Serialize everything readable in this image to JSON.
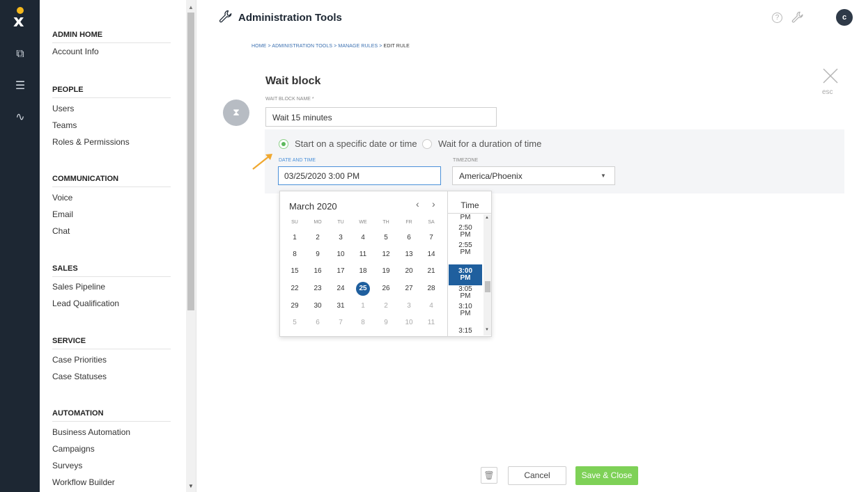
{
  "app": {
    "title": "Administration Tools",
    "avatar_initial": "c",
    "help_glyph": "?"
  },
  "sidebar": {
    "sections": [
      {
        "title": "ADMIN HOME",
        "items": [
          "Account Info"
        ]
      },
      {
        "title": "PEOPLE",
        "items": [
          "Users",
          "Teams",
          "Roles & Permissions"
        ]
      },
      {
        "title": "COMMUNICATION",
        "items": [
          "Voice",
          "Email",
          "Chat"
        ]
      },
      {
        "title": "SALES",
        "items": [
          "Sales Pipeline",
          "Lead Qualification"
        ]
      },
      {
        "title": "SERVICE",
        "items": [
          "Case Priorities",
          "Case Statuses"
        ]
      },
      {
        "title": "AUTOMATION",
        "items": [
          "Business Automation",
          "Campaigns",
          "Surveys",
          "Workflow Builder"
        ]
      }
    ]
  },
  "breadcrumb": {
    "home": "HOME",
    "admin": "ADMINISTRATION TOOLS",
    "rules": "MANAGE RULES",
    "current": "EDIT RULE",
    "sep": ">"
  },
  "form": {
    "block_title": "Wait block",
    "name_label": "WAIT BLOCK NAME *",
    "name_value": "Wait 15 minutes",
    "option_specific": "Start on a specific date or time",
    "option_duration": "Wait for a duration of time",
    "selected_option": "specific",
    "datetime_label": "DATE AND TIME",
    "datetime_value": "03/25/2020 3:00 PM",
    "timezone_label": "TIMEZONE",
    "timezone_value": "America/Phoenix",
    "esc_label": "esc"
  },
  "calendar": {
    "month_label": "March 2020",
    "weekdays": [
      "SU",
      "MO",
      "TU",
      "WE",
      "TH",
      "FR",
      "SA"
    ],
    "weeks": [
      [
        "1",
        "2",
        "3",
        "4",
        "5",
        "6",
        "7"
      ],
      [
        "8",
        "9",
        "10",
        "11",
        "12",
        "13",
        "14"
      ],
      [
        "15",
        "16",
        "17",
        "18",
        "19",
        "20",
        "21"
      ],
      [
        "22",
        "23",
        "24",
        "25",
        "26",
        "27",
        "28"
      ],
      [
        "29",
        "30",
        "31",
        "1",
        "2",
        "3",
        "4"
      ],
      [
        "5",
        "6",
        "7",
        "8",
        "9",
        "10",
        "11"
      ]
    ],
    "selected_day": "25",
    "time_header": "Time",
    "times": [
      {
        "time": "PM",
        "partial": true
      },
      {
        "time": "2:50",
        "period": "PM"
      },
      {
        "time": "2:55",
        "period": "PM"
      },
      {
        "time": "3:00",
        "period": "PM",
        "selected": true
      },
      {
        "time": "3:05",
        "period": "PM"
      },
      {
        "time": "3:10",
        "period": "PM"
      },
      {
        "time": "3:15",
        "partial": true
      }
    ]
  },
  "actions": {
    "cancel": "Cancel",
    "save": "Save & Close"
  },
  "colors": {
    "rail": "#1d2733",
    "accent_blue": "#1f5f9e",
    "save_green": "#7ed157",
    "radio_green": "#5cb85c",
    "arrow_orange": "#f0a830"
  }
}
